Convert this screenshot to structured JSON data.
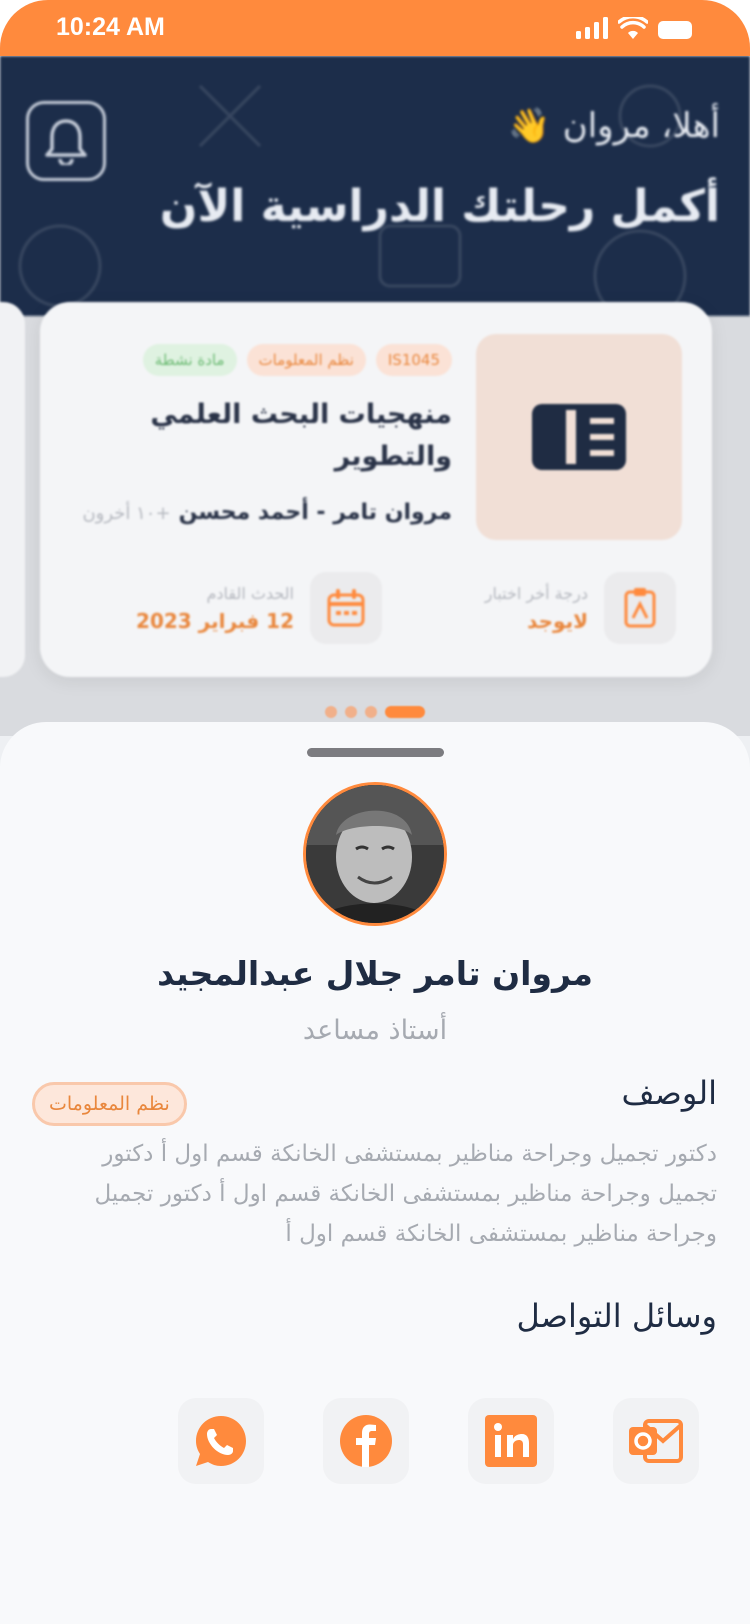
{
  "status_bar": {
    "time": "10:24 AM"
  },
  "hero": {
    "greeting": "أهلا، مروان",
    "greeting_emoji": "👋",
    "title": "أكمل رحلتك الدراسية الآن"
  },
  "course_card": {
    "tags": [
      "IS1045",
      "نظم المعلومات",
      "مادة نشطة"
    ],
    "name": "منهجيات البحث العلمي والتطوير",
    "teachers": "مروان تامر - أحمد محسن",
    "teachers_more": "+١٠ أخرون",
    "last_exam_label": "درجة أخر اختبار",
    "last_exam_value": "لايوجد",
    "next_event_label": "الحدث القادم",
    "next_event_value": "12 فبراير 2023"
  },
  "profile": {
    "name": "مروان تامر جلال عبدالمجيد",
    "role": "أستاذ مساعد",
    "description_title": "الوصف",
    "department_tag": "نظم المعلومات",
    "description": "دكتور تجميل وجراحة مناظير بمستشفى الخانكة قسم اول أ دكتور تجميل وجراحة مناظير بمستشفى الخانكة قسم اول أ دكتور تجميل وجراحة مناظير بمستشفى الخانكة قسم اول أ",
    "contacts_title": "وسائل التواصل",
    "contacts": [
      "outlook-icon",
      "linkedin-icon",
      "facebook-icon",
      "whatsapp-icon"
    ]
  },
  "colors": {
    "accent": "#ff8a3d",
    "navy": "#1c2d4a"
  }
}
